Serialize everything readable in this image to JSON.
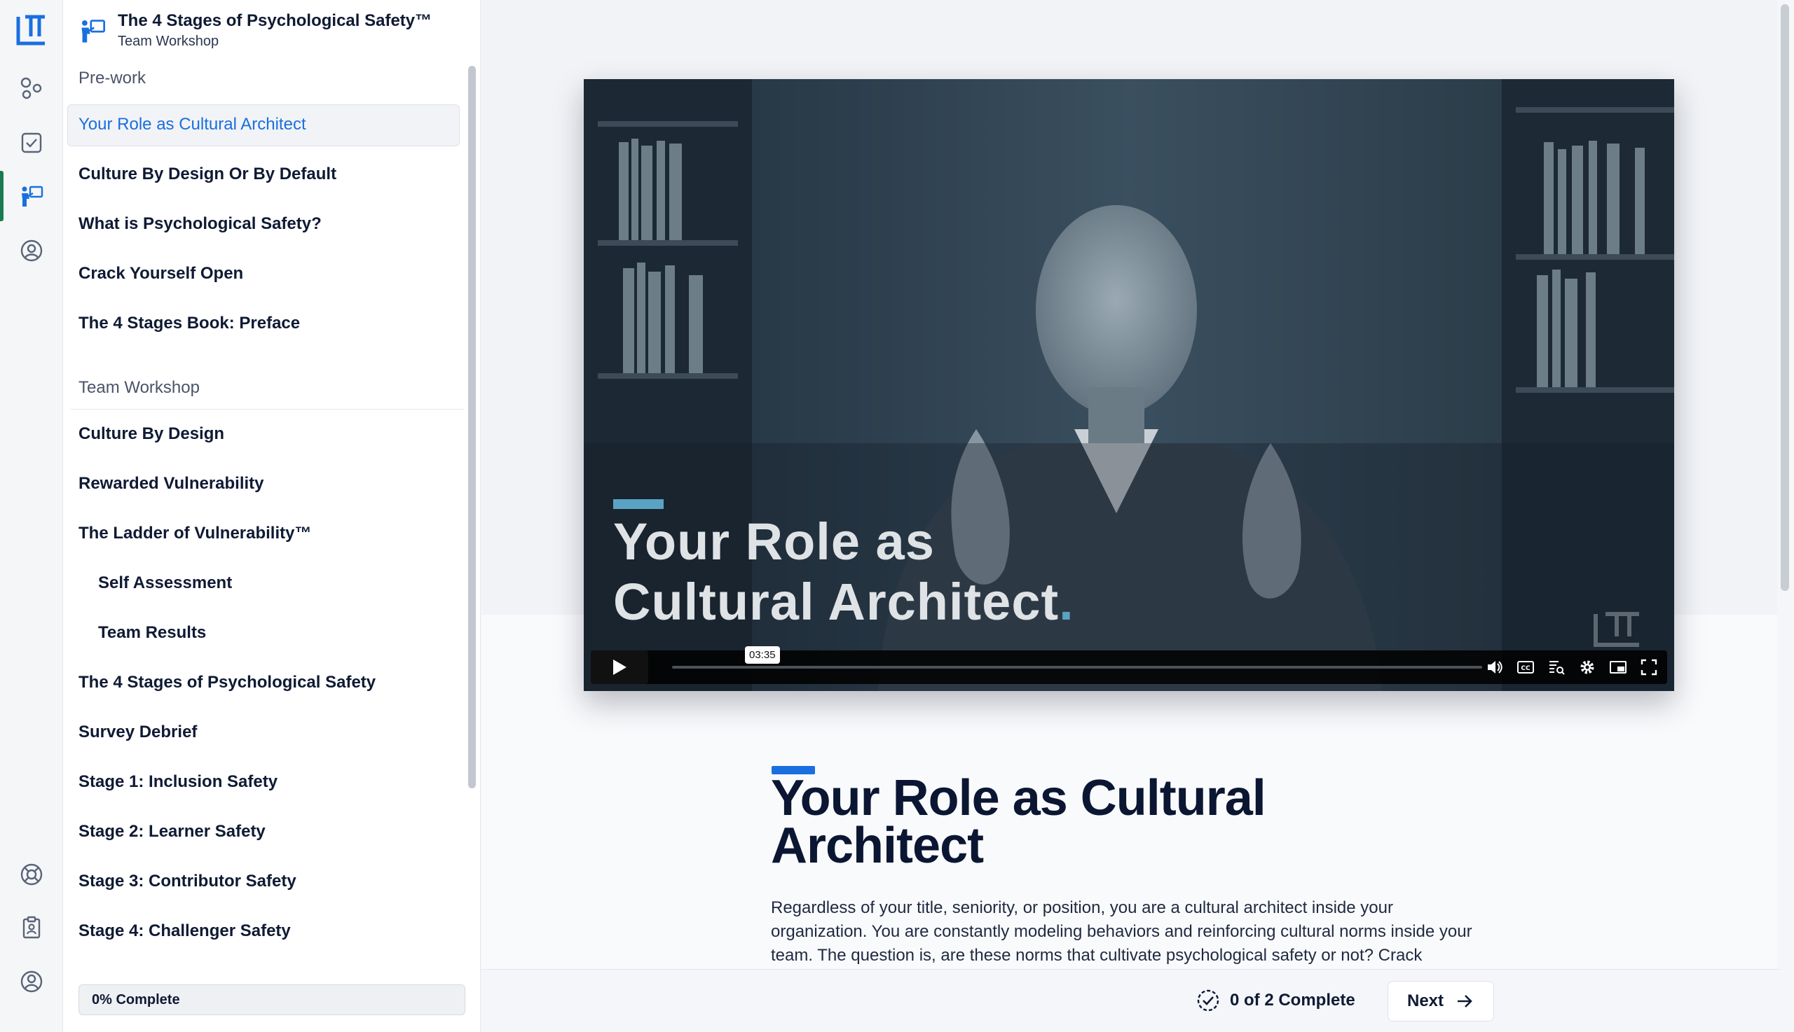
{
  "colors": {
    "brand_blue": "#1a6fe0",
    "active_rail": "#1a7a50",
    "video_accent": "#5ba3c2",
    "navy": "#0b1633"
  },
  "rail": {
    "icons": [
      "ltt-logo-icon",
      "shapes-icon",
      "checklist-icon",
      "presentation-icon",
      "user-circle-icon",
      "lifebuoy-icon",
      "clipboard-user-icon",
      "profile-icon"
    ]
  },
  "course": {
    "title": "The 4 Stages of Psychological Safety™",
    "subtitle": "Team Workshop"
  },
  "sections": [
    {
      "label": "Pre-work",
      "lessons": [
        {
          "label": "Your Role as Cultural Architect",
          "active": true
        },
        {
          "label": "Culture By Design Or By Default"
        },
        {
          "label": "What is Psychological Safety?"
        },
        {
          "label": "Crack Yourself Open"
        },
        {
          "label": "The 4 Stages Book: Preface"
        }
      ]
    },
    {
      "label": "Team Workshop",
      "lessons": [
        {
          "label": "Culture By Design"
        },
        {
          "label": "Rewarded Vulnerability"
        },
        {
          "label": "The Ladder of Vulnerability™"
        },
        {
          "label": "Self Assessment",
          "sub": true
        },
        {
          "label": "Team Results",
          "sub": true
        },
        {
          "label": "The 4 Stages of Psychological Safety"
        },
        {
          "label": "Survey Debrief"
        },
        {
          "label": "Stage 1: Inclusion Safety"
        },
        {
          "label": "Stage 2: Learner Safety"
        },
        {
          "label": "Stage 3: Contributor Safety"
        },
        {
          "label": "Stage 4: Challenger Safety"
        }
      ]
    }
  ],
  "progress": {
    "label": "0% Complete",
    "percent": 0
  },
  "video": {
    "title_line1": "Your Role as",
    "title_line2": "Cultural Architect",
    "title_dot": ".",
    "time": "03:35",
    "progress": 0
  },
  "lesson": {
    "heading": "Your Role as Cultural Architect",
    "body": "Regardless of your title, seniority, or position, you are a cultural architect inside your organization. You are constantly modeling behaviors and reinforcing cultural norms inside your team. The question is, are these norms that cultivate psychological safety or not? Crack"
  },
  "footer": {
    "complete_label": "0 of 2 Complete",
    "next_label": "Next"
  }
}
